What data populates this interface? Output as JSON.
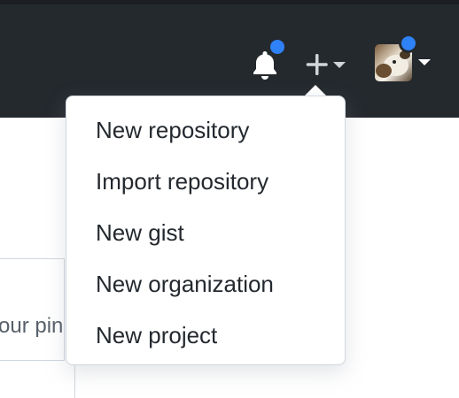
{
  "header": {
    "background_color": "#24292e",
    "notifications": {
      "icon": "bell-icon",
      "has_unread": true
    },
    "create_menu": {
      "icon": "plus-icon",
      "caret_icon": "caret-down-icon"
    },
    "user_menu": {
      "icon": "avatar",
      "has_status": true,
      "caret_icon": "caret-down-icon"
    },
    "indicator_color": "#2f81f7"
  },
  "dropdown": {
    "items": [
      {
        "label": "New repository"
      },
      {
        "label": "Import repository"
      },
      {
        "label": "New gist"
      },
      {
        "label": "New organization"
      },
      {
        "label": "New project"
      }
    ]
  },
  "background": {
    "partial_text": "our pin"
  }
}
